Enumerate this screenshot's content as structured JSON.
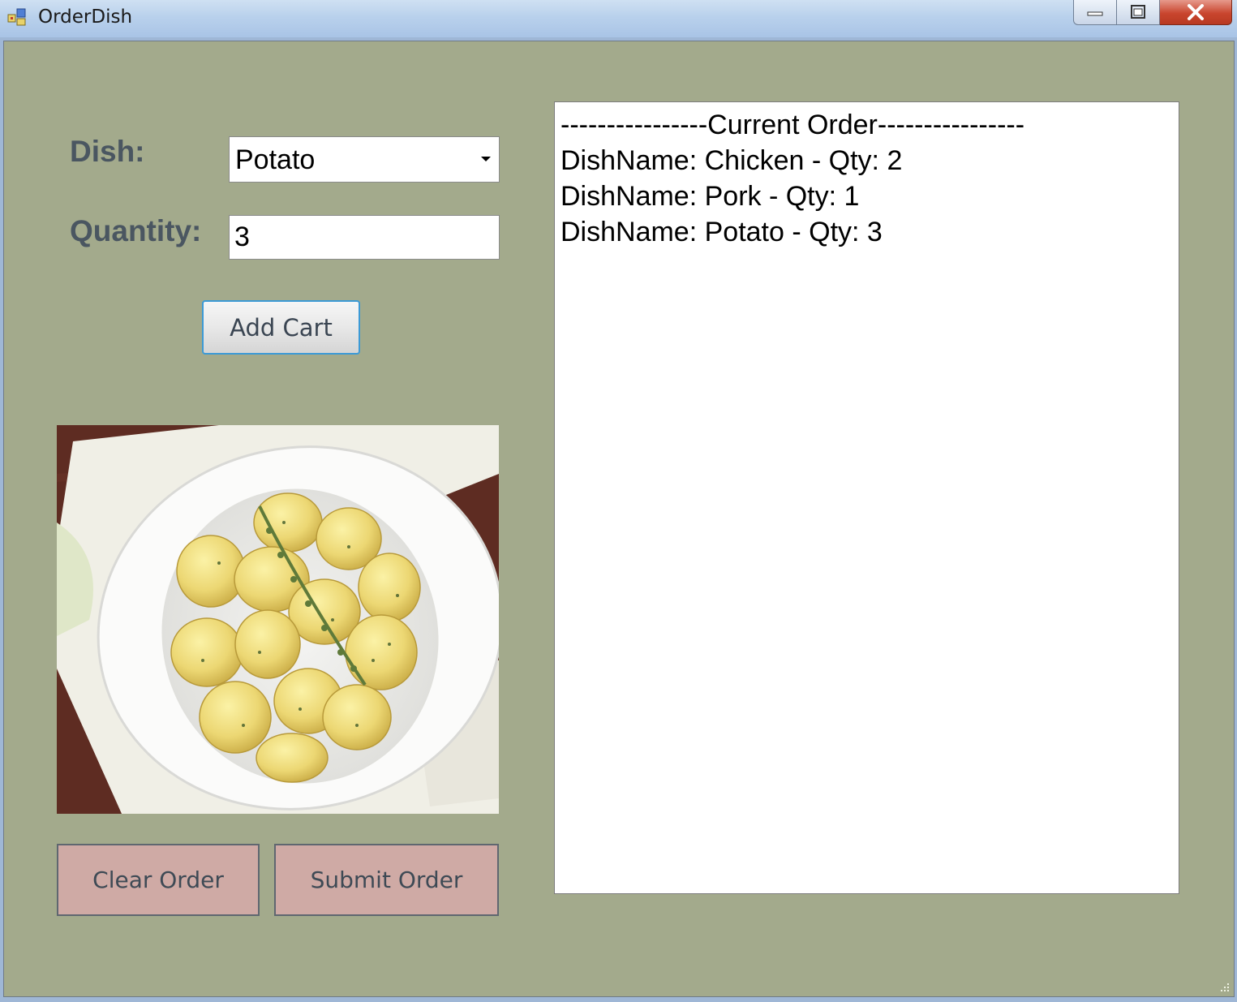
{
  "window": {
    "title": "OrderDish",
    "controls": [
      "minimize-icon",
      "maximize-icon",
      "close-icon"
    ]
  },
  "form": {
    "dish_label": "Dish:",
    "quantity_label": "Quantity:",
    "dish_selected": "Potato",
    "quantity_value": "3",
    "add_button": "Add Cart",
    "clear_button": "Clear Order",
    "submit_button": "Submit Order"
  },
  "picture": {
    "subject": "bowl-of-boiled-potatoes-with-herbs"
  },
  "order_list": {
    "items": [
      "----------------Current Order----------------",
      "DishName: Chicken - Qty: 2",
      "DishName: Pork - Qty: 1",
      "DishName: Potato - Qty: 3"
    ]
  },
  "colors": {
    "form_background": "#a3aa8c",
    "action_button": "#cfaaa5",
    "add_button_border": "#3c9ad6"
  }
}
